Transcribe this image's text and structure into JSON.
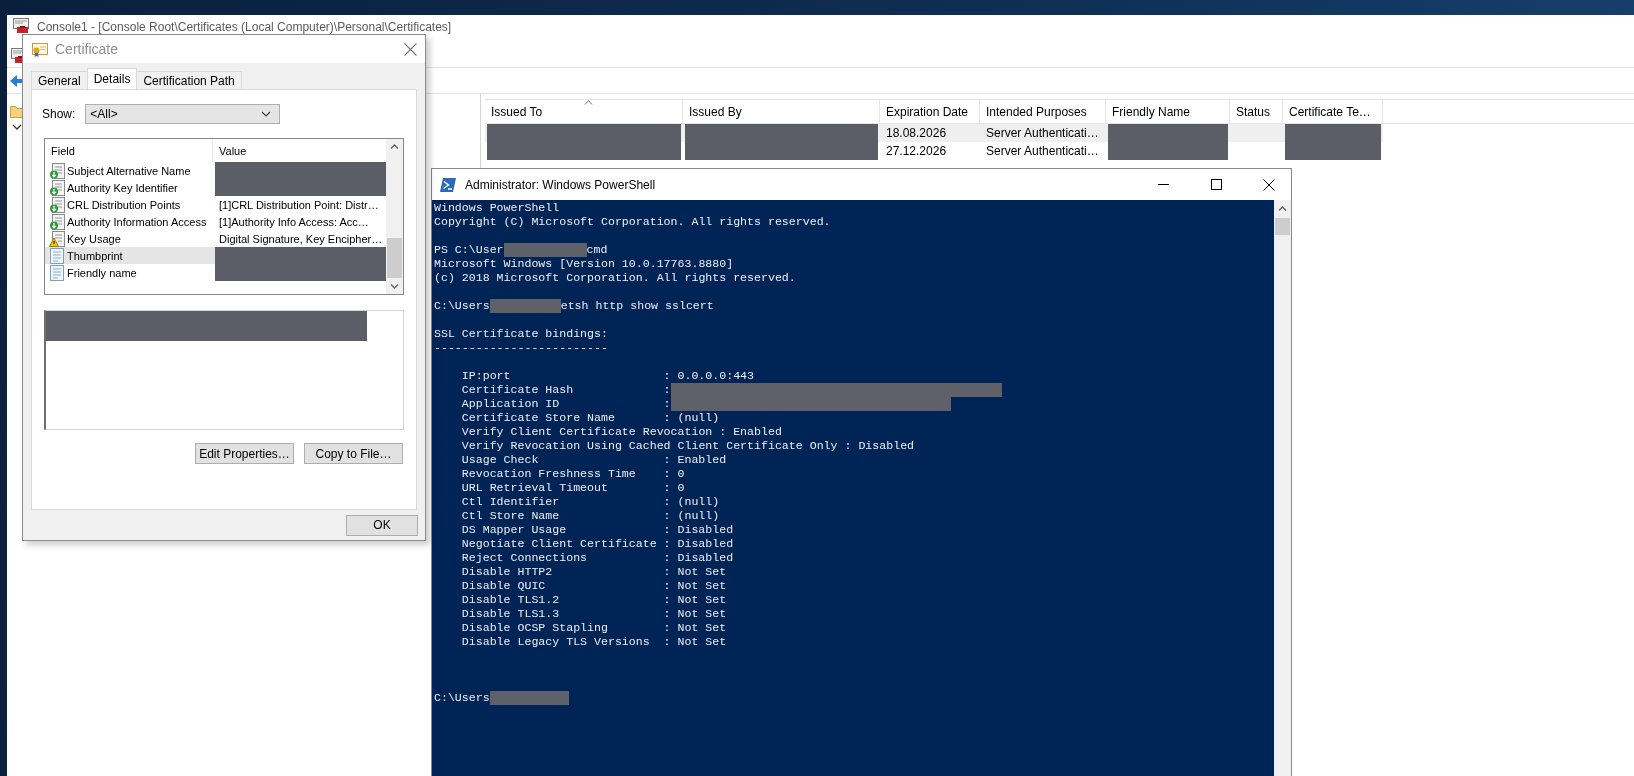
{
  "mmc_window": {
    "title": "Console1 - [Console Root\\Certificates (Local Computer)\\Personal\\Certificates]",
    "table": {
      "columns": [
        {
          "label": "Issued To",
          "sorted": true
        },
        {
          "label": "Issued By",
          "sorted": false
        },
        {
          "label": "Expiration Date",
          "sorted": false
        },
        {
          "label": "Intended Purposes",
          "sorted": false
        },
        {
          "label": "Friendly Name",
          "sorted": false
        },
        {
          "label": "Status",
          "sorted": false
        },
        {
          "label": "Certificate Te…",
          "sorted": false
        }
      ],
      "rows": [
        {
          "selected": true,
          "cells": [
            {
              "kind": "redacted"
            },
            {
              "kind": "redacted"
            },
            {
              "kind": "text",
              "text": "18.08.2026"
            },
            {
              "kind": "text",
              "text": "Server Authenticati…"
            },
            {
              "kind": "redacted"
            },
            {
              "kind": "blank"
            },
            {
              "kind": "redacted"
            }
          ]
        },
        {
          "selected": false,
          "cells": [
            {
              "kind": "redacted"
            },
            {
              "kind": "redacted"
            },
            {
              "kind": "text",
              "text": "27.12.2026"
            },
            {
              "kind": "text",
              "text": "Server Authenticati…"
            },
            {
              "kind": "redacted"
            },
            {
              "kind": "blank"
            },
            {
              "kind": "redacted"
            }
          ]
        }
      ]
    }
  },
  "cert_dialog": {
    "title": "Certificate",
    "tabs": [
      {
        "label": "General",
        "selected": false
      },
      {
        "label": "Details",
        "selected": true
      },
      {
        "label": "Certification Path",
        "selected": false
      }
    ],
    "show_label": "Show:",
    "show_value": "<All>",
    "columns": [
      "Field",
      "Value"
    ],
    "fields": [
      {
        "kind": "extension",
        "name": "Subject Alternative Name",
        "value": {
          "kind": "redacted"
        },
        "selected": false
      },
      {
        "kind": "extension",
        "name": "Authority Key Identifier",
        "value": {
          "kind": "redacted"
        },
        "selected": false
      },
      {
        "kind": "extension",
        "name": "CRL Distribution Points",
        "value": {
          "kind": "text",
          "text": "[1]CRL Distribution Point: Distr…"
        },
        "selected": false
      },
      {
        "kind": "extension",
        "name": "Authority Information Access",
        "value": {
          "kind": "text",
          "text": "[1]Authority Info Access: Acc…"
        },
        "selected": false
      },
      {
        "kind": "critical",
        "name": "Key Usage",
        "value": {
          "kind": "text",
          "text": "Digital Signature, Key Encipher…"
        },
        "selected": false
      },
      {
        "kind": "property",
        "name": "Thumbprint",
        "value": {
          "kind": "redacted"
        },
        "selected": true
      },
      {
        "kind": "property",
        "name": "Friendly name",
        "value": {
          "kind": "redacted"
        },
        "selected": false
      }
    ],
    "detail": {
      "kind": "redacted"
    },
    "buttons": [
      "Edit Properties…",
      "Copy to File…"
    ],
    "ok_button": "OK"
  },
  "powershell": {
    "title": "Administrator: Windows PowerShell",
    "lines": [
      {
        "kind": "text",
        "text": "Windows PowerShell"
      },
      {
        "kind": "text",
        "text": "Copyright (C) Microsoft Corporation. All rights reserved."
      },
      {
        "kind": "blank"
      },
      {
        "kind": "redacted",
        "before": "PS C:\\User",
        "after": "cmd"
      },
      {
        "kind": "text",
        "text": "Microsoft Windows [Version 10.0.17763.8880]"
      },
      {
        "kind": "text",
        "text": "(c) 2018 Microsoft Corporation. All rights reserved."
      },
      {
        "kind": "blank"
      },
      {
        "kind": "redacted",
        "before": "C:\\Users",
        "after": "etsh http show sslcert"
      },
      {
        "kind": "blank"
      },
      {
        "kind": "text",
        "text": "SSL Certificate bindings:"
      },
      {
        "kind": "text",
        "text": "-------------------------"
      },
      {
        "kind": "blank"
      },
      {
        "kind": "setting",
        "key": "IP:port",
        "value": ": 0.0.0.0:443",
        "redacted": false
      },
      {
        "kind": "setting",
        "key": "Certificate Hash",
        "value": ":",
        "redacted": true
      },
      {
        "kind": "setting",
        "key": "Application ID",
        "value": ":",
        "redacted": true
      },
      {
        "kind": "setting",
        "key": "Certificate Store Name",
        "value": ": (null)",
        "redacted": false
      },
      {
        "kind": "text",
        "text": "    Verify Client Certificate Revocation : Enabled"
      },
      {
        "kind": "text",
        "text": "    Verify Revocation Using Cached Client Certificate Only : Disabled"
      },
      {
        "kind": "setting",
        "key": "Usage Check",
        "value": ": Enabled",
        "redacted": false
      },
      {
        "kind": "setting",
        "key": "Revocation Freshness Time",
        "value": ": 0",
        "redacted": false
      },
      {
        "kind": "setting",
        "key": "URL Retrieval Timeout",
        "value": ": 0",
        "redacted": false
      },
      {
        "kind": "setting",
        "key": "Ctl Identifier",
        "value": ": (null)",
        "redacted": false
      },
      {
        "kind": "setting",
        "key": "Ctl Store Name",
        "value": ": (null)",
        "redacted": false
      },
      {
        "kind": "setting",
        "key": "DS Mapper Usage",
        "value": ": Disabled",
        "redacted": false
      },
      {
        "kind": "setting",
        "key": "Negotiate Client Certificate",
        "value": ": Disabled",
        "redacted": false
      },
      {
        "kind": "setting",
        "key": "Reject Connections",
        "value": ": Disabled",
        "redacted": false
      },
      {
        "kind": "setting",
        "key": "Disable HTTP2",
        "value": ": Not Set",
        "redacted": false
      },
      {
        "kind": "setting",
        "key": "Disable QUIC",
        "value": ": Not Set",
        "redacted": false
      },
      {
        "kind": "setting",
        "key": "Disable TLS1.2",
        "value": ": Not Set",
        "redacted": false
      },
      {
        "kind": "setting",
        "key": "Disable TLS1.3",
        "value": ": Not Set",
        "redacted": false
      },
      {
        "kind": "setting",
        "key": "Disable OCSP Stapling",
        "value": ": Not Set",
        "redacted": false
      },
      {
        "kind": "setting",
        "key": "Disable Legacy TLS Versions",
        "value": ": Not Set",
        "redacted": false
      },
      {
        "kind": "blank"
      },
      {
        "kind": "blank"
      },
      {
        "kind": "blank"
      },
      {
        "kind": "redacted",
        "before": "C:\\Users"
      }
    ]
  }
}
